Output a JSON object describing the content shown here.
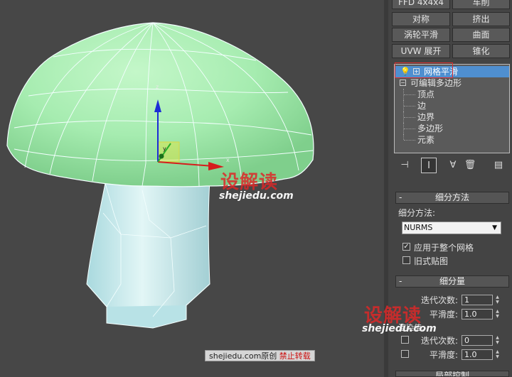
{
  "watermarks": {
    "brand": "设解读",
    "url": "shejiedu.com",
    "credit_prefix": "shejiedu.com原创",
    "credit_warn": "禁止转载"
  },
  "viewport": {
    "axes": {
      "x": "x",
      "y": "y",
      "z": "z"
    },
    "colors": {
      "cap": "#a6ecb0",
      "stem": "#cdeef0",
      "background": "#474747"
    }
  },
  "modifier_buttons": [
    {
      "label": "FFD 4x4x4"
    },
    {
      "label": "车削"
    },
    {
      "label": "对称"
    },
    {
      "label": "挤出"
    },
    {
      "label": "涡轮平滑"
    },
    {
      "label": "曲面"
    },
    {
      "label": "UVW 展开"
    },
    {
      "label": "锥化"
    }
  ],
  "stack": {
    "items": [
      {
        "label": "网格平滑",
        "selected": true
      },
      {
        "label": "可编辑多边形"
      },
      {
        "label": "顶点"
      },
      {
        "label": "边"
      },
      {
        "label": "边界"
      },
      {
        "label": "多边形"
      },
      {
        "label": "元素"
      }
    ]
  },
  "subdivision_method": {
    "title": "细分方法",
    "method_label": "细分方法:",
    "method_value": "NURMS",
    "apply_whole_mesh": "应用于整个网格",
    "legacy_mapping": "旧式贴图"
  },
  "subdivision_amount": {
    "title": "细分量",
    "iterations_label": "迭代次数:",
    "iterations_value": "1",
    "smoothness_label": "平滑度:",
    "smoothness_value": "1.0",
    "render_label": "渲染值:",
    "render_iterations_value": "0",
    "render_smoothness_value": "1.0"
  },
  "next_rollout": {
    "title": "局部控制"
  }
}
